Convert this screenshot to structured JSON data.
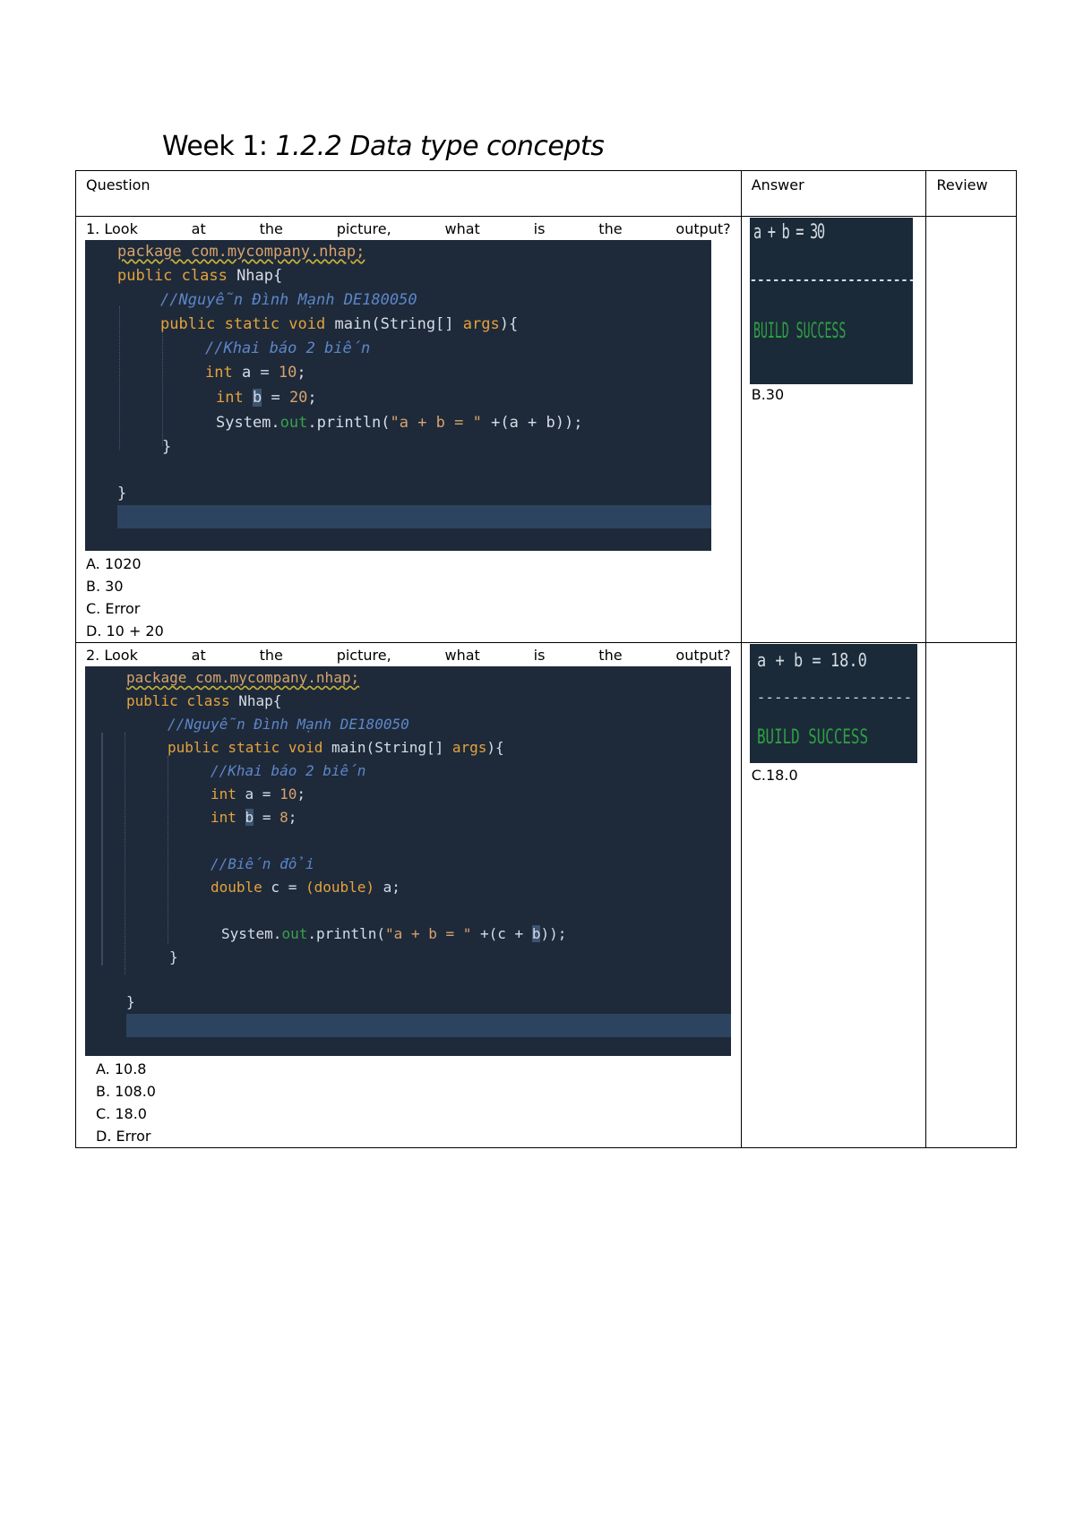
{
  "title": {
    "prefix": "Week 1: ",
    "italic": "1.2.2 Data type concepts"
  },
  "table": {
    "headers": {
      "question": "Question",
      "answer": "Answer",
      "review": "Review"
    },
    "questions": [
      {
        "prompt_words": [
          "1. Look",
          "at",
          "the",
          "picture,",
          "what",
          "is",
          "the",
          "output?"
        ],
        "code": {
          "package": "package com.mycompany.nhap;",
          "class_decl_kw": "public class",
          "class_decl_rest": " Nhap{",
          "author_comment": "//Nguyễn Đình Mạnh DE180050",
          "main_kw": "public static void",
          "main_rest": " main(String[] ",
          "main_args": "args",
          "main_end": "){",
          "decl_comment": "//Khai báo 2 biến",
          "int_kw": "int",
          "line_a_rest": " a = ",
          "line_a_num": "10",
          "line_b_var": "b",
          "line_b_rest": " = ",
          "line_b_num": "20",
          "println_pre": "System.",
          "println_field": "out",
          "println_mid": ".println(",
          "println_str": "\"a + b = \"",
          "println_end": " +(a + b));",
          "brace_close_inner": "}",
          "brace_close_outer": "}"
        },
        "options": [
          "A. 1020",
          "B. 30",
          "C. Error",
          "D. 10 + 20"
        ],
        "output": {
          "line1": "a + b = 30",
          "line2": "------------------------",
          "line3": "BUILD SUCCESS"
        },
        "answer": "B.30",
        "review": ""
      },
      {
        "prompt_words": [
          "2. Look",
          "at",
          "the",
          "picture,",
          "what",
          "is",
          "the",
          "output?"
        ],
        "code": {
          "package": "package com.mycompany.nhap;",
          "class_decl_kw": "public class",
          "class_decl_rest": " Nhap{",
          "author_comment": "//Nguyễn Đình Mạnh DE180050",
          "main_kw": "public static void",
          "main_rest": " main(String[] ",
          "main_args": "args",
          "main_end": "){",
          "decl_comment": "//Khai báo 2 biến",
          "int_kw": "int",
          "line_a_rest": " a = ",
          "line_a_num": "10",
          "line_b_var": "b",
          "line_b_rest": " = ",
          "line_b_num": "8",
          "cast_comment": "//Biến đổi",
          "double_kw": "double",
          "cast_rest": " c = ",
          "cast_paren": "(double)",
          "cast_end": " a;",
          "println_pre": "System.",
          "println_field": "out",
          "println_mid": ".println(",
          "println_str": "\"a + b = \"",
          "println_end_a": " +(c + ",
          "println_end_b": "b",
          "println_end_c": "));",
          "brace_close_inner": "}",
          "brace_close_outer": "}"
        },
        "options": [
          "A. 10.8",
          "B. 108.0",
          "C. 18.0",
          "D. Error"
        ],
        "output": {
          "line1": "a + b = 18.0",
          "line2": "------------------",
          "line3": "BUILD SUCCESS"
        },
        "answer": "C.18.0",
        "review": ""
      }
    ]
  }
}
